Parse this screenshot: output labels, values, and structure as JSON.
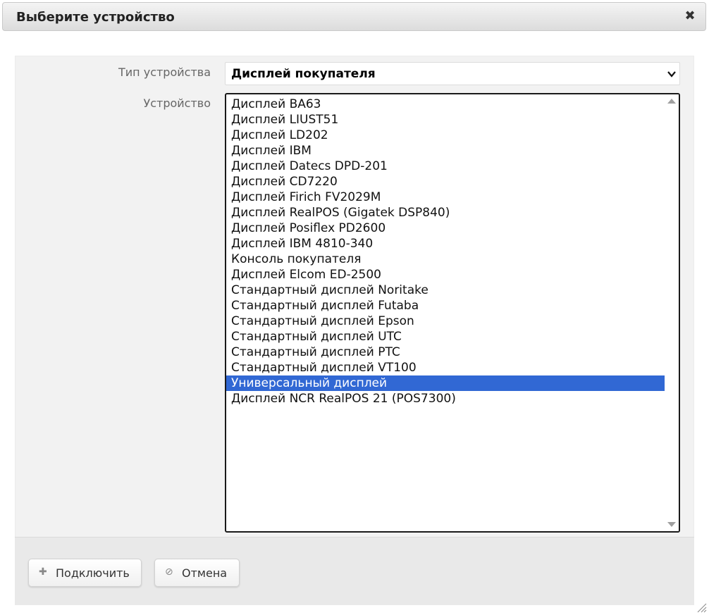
{
  "dialog": {
    "title": "Выберите устройство",
    "close_glyph": "✖"
  },
  "form": {
    "type_label": "Тип устройства",
    "type_value": "Дисплей покупателя",
    "device_label": "Устройство",
    "devices": [
      "Дисплей BA63",
      "Дисплей LIUST51",
      "Дисплей LD202",
      "Дисплей IBM",
      "Дисплей Datecs DPD-201",
      "Дисплей CD7220",
      "Дисплей Firich FV2029M",
      "Дисплей RealPOS (Gigatek DSP840)",
      "Дисплей Posiflex PD2600",
      "Дисплей IBM 4810-340",
      "Консоль покупателя",
      "Дисплей Elcom ED-2500",
      "Стандартный дисплей Noritake",
      "Стандартный дисплей Futaba",
      "Стандартный дисплей Epson",
      "Стандартный дисплей UTC",
      "Стандартный дисплей PTC",
      "Стандартный дисплей VT100",
      "Универсальный дисплей",
      "Дисплей NCR RealPOS 21 (POS7300)"
    ],
    "selected_device": "Универсальный дисплей"
  },
  "footer": {
    "connect_label": "Подключить",
    "connect_icon": "plus-icon",
    "connect_glyph": "✚",
    "cancel_label": "Отмена",
    "cancel_icon": "cancel-icon",
    "cancel_glyph": "⊘"
  },
  "colors": {
    "selection": "#3168d4",
    "panel": "#f2f2f2"
  }
}
